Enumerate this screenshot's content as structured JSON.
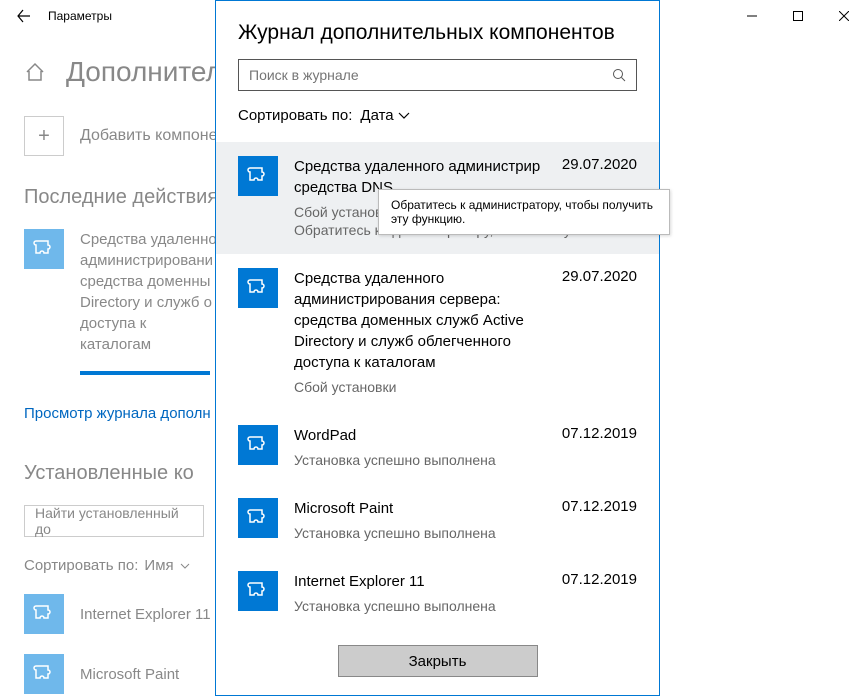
{
  "titlebar": {
    "text": "Параметры"
  },
  "page": {
    "title": "Дополнител",
    "add_component": "Добавить компоне",
    "recent_head": "Последние действия",
    "recent_item": "Средства удаленно администрировани средства доменны Directory и служб о доступа к каталогам",
    "history_link": "Просмотр журнала дополн",
    "installed_head": "Установленные ко",
    "search_placeholder": "Найти установленный до",
    "sort_label": "Сортировать по:",
    "sort_value": "Имя",
    "installed": [
      {
        "name": "Internet Explorer 11"
      },
      {
        "name": "Microsoft Paint"
      }
    ]
  },
  "modal": {
    "title": "Журнал дополнительных компонентов",
    "search_placeholder": "Поиск в журнале",
    "sort_label": "Сортировать по:",
    "sort_value": "Дата",
    "close": "Закрыть",
    "entries": [
      {
        "title": "Средства удаленного администрир средства DNS",
        "date": "29.07.2020",
        "status": "Сбой установки",
        "desc": "Обратитесь к администратору, чтобы получить..."
      },
      {
        "title": "Средства удаленного администрирования сервера: средства доменных служб Active Directory и служб облегченного доступа к каталогам",
        "date": "29.07.2020",
        "status": "Сбой установки",
        "desc": ""
      },
      {
        "title": "WordPad",
        "date": "07.12.2019",
        "status": "Установка успешно выполнена",
        "desc": ""
      },
      {
        "title": "Microsoft Paint",
        "date": "07.12.2019",
        "status": "Установка успешно выполнена",
        "desc": ""
      },
      {
        "title": "Internet Explorer 11",
        "date": "07.12.2019",
        "status": "Установка успешно выполнена",
        "desc": ""
      }
    ]
  },
  "tooltip": {
    "text": "Обратитесь к администратору, чтобы получить эту функцию."
  }
}
